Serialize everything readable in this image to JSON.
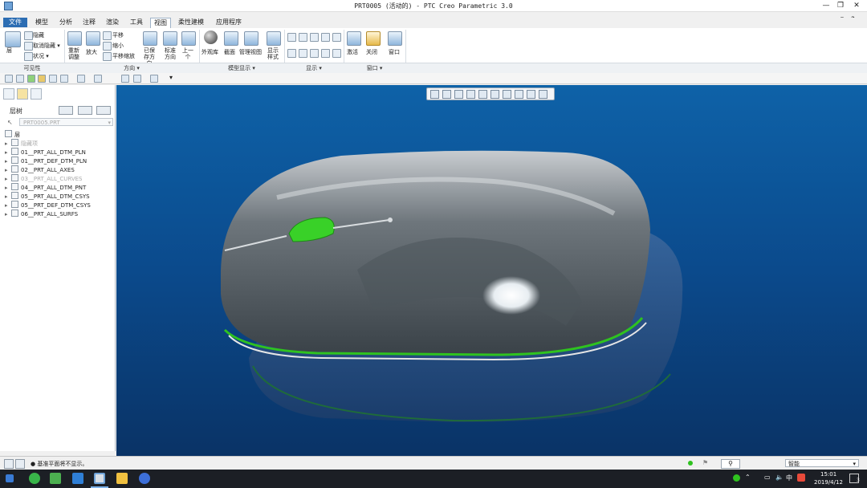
{
  "window": {
    "title": "PRT0005 (活动的) - PTC Creo Parametric 3.0"
  },
  "tabs": [
    {
      "label": "文件 ▾"
    },
    {
      "label": "模型"
    },
    {
      "label": "分析"
    },
    {
      "label": "注释"
    },
    {
      "label": "渲染"
    },
    {
      "label": "工具"
    },
    {
      "label": "视图"
    },
    {
      "label": "柔性建模"
    },
    {
      "label": "应用程序"
    }
  ],
  "ribbon": {
    "visibility": {
      "layer": "层",
      "hide": "隐藏",
      "unhide": "取消隐藏 ▾",
      "status": "状况 ▾",
      "group": "可见性"
    },
    "orientation": {
      "refit": "重新调整",
      "zoom_in": "放大",
      "pan": "平移",
      "zoom_out": "缩小",
      "pan_zoom": "平移缩放",
      "saved": "已保存方向",
      "standard": "标准方向",
      "previous": "上一个",
      "group": "方向 ▾"
    },
    "model_display": {
      "appearance": "外观库",
      "section": "截面",
      "manage_views": "管理视图",
      "display_style": "显示样式",
      "group": "模型显示 ▾"
    },
    "show": {
      "group": "显示 ▾"
    },
    "window": {
      "activate": "激活",
      "close": "关闭",
      "windows": "窗口",
      "group": "窗口 ▾"
    }
  },
  "left_panel": {
    "tree_label": "层树",
    "model_name": "PRT0005.PRT",
    "root": "层",
    "items": [
      {
        "label": "隐藏项",
        "dim": true
      },
      {
        "label": "01__PRT_ALL_DTM_PLN",
        "dim": false
      },
      {
        "label": "01__PRT_DEF_DTM_PLN",
        "dim": false
      },
      {
        "label": "02__PRT_ALL_AXES",
        "dim": false
      },
      {
        "label": "03__PRT_ALL_CURVES",
        "dim": true
      },
      {
        "label": "04__PRT_ALL_DTM_PNT",
        "dim": false
      },
      {
        "label": "05__PRT_ALL_DTM_CSYS",
        "dim": false
      },
      {
        "label": "05__PRT_DEF_DTM_CSYS",
        "dim": false
      },
      {
        "label": "06__PRT_ALL_SURFS",
        "dim": false
      }
    ]
  },
  "status": {
    "message": "● 基准平面将不显示。",
    "filter": "智能"
  },
  "taskbar": {
    "ime": "中",
    "time": "15:01",
    "date": "2019/4/12",
    "notify_count": "3"
  },
  "colors": {
    "viewport_top": "#0e62a8",
    "viewport_bottom": "#0a3366",
    "accent_green": "#2fc21f"
  }
}
